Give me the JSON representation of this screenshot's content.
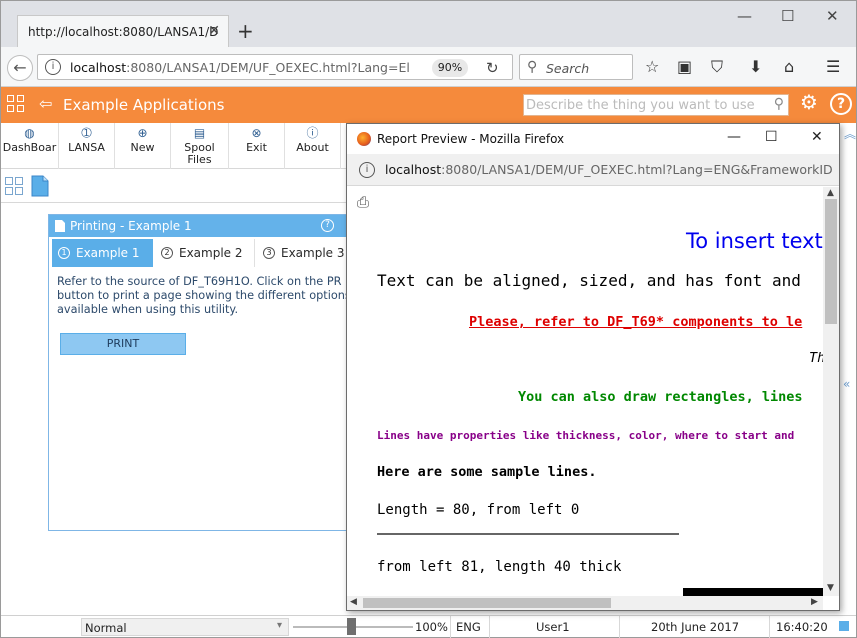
{
  "browser": {
    "tab_title": "http://localhost:8080/LANSA1/D",
    "new_tab": "+",
    "url_host": "localhost",
    "url_rest": ":8080/LANSA1/DEM/UF_OEXEC.html?Lang=El",
    "zoom": "90%",
    "search_placeholder": "Search",
    "window_min": "—",
    "window_max": "☐",
    "window_close": "✕"
  },
  "app": {
    "title": "Example Applications",
    "search_placeholder": "Describe the thing you want to use",
    "help_icon_char": "?",
    "settings_icon_char": "⚙"
  },
  "toolbar": {
    "items": [
      {
        "label": "DashBoar",
        "icon": "globe-icon",
        "glyph": "◍"
      },
      {
        "label": "LANSA",
        "icon": "info-circle-icon",
        "glyph": "➀"
      },
      {
        "label": "New",
        "icon": "plus-circle-icon",
        "glyph": "⊕"
      },
      {
        "label": "Spool Files",
        "icon": "document-icon",
        "glyph": "▤"
      },
      {
        "label": "Exit",
        "icon": "close-circle-icon",
        "glyph": "⊗"
      },
      {
        "label": "About",
        "icon": "about-icon",
        "glyph": "ⓘ"
      }
    ]
  },
  "panel": {
    "title": "Printing - Example 1",
    "tabs": [
      {
        "num": "1",
        "label": "Example 1"
      },
      {
        "num": "2",
        "label": "Example 2"
      },
      {
        "num": "3",
        "label": "Example 3"
      }
    ],
    "description_lines": [
      "Refer to the source of DF_T69H1O. Click on the PR",
      "button to print a page showing the different options",
      "available when using this utility."
    ],
    "print_button": "PRINT"
  },
  "status": {
    "mode": "Normal",
    "zoom_value_percent": 100,
    "zoom": "100%",
    "lang": "ENG",
    "user": "User1",
    "date": "20th June 2017",
    "time": "16:40:20"
  },
  "popup": {
    "title": "Report Preview - Mozilla Firefox",
    "url_host": "localhost",
    "url_rest": ":8080/LANSA1/DEM/UF_OEXEC.html?Lang=ENG&FrameworkID",
    "report_lines": [
      {
        "text": "To insert text",
        "color": "#0000ee"
      },
      {
        "text": "Text can be aligned, sized, and has font and",
        "color": "#000000"
      },
      {
        "text": "Please, refer to DF_T69* components to le",
        "color": "#dd0000"
      },
      {
        "text": "Th",
        "color": "#000000"
      },
      {
        "text": "You can also draw rectangles, lines",
        "color": "#008800"
      },
      {
        "text": "Lines have properties like thickness, color, where to start and",
        "color": "#880088"
      },
      {
        "text": "Here are some sample lines.",
        "color": "#000000"
      },
      {
        "text": "Length = 80, from left 0",
        "color": "#000000"
      },
      {
        "text": "from left 81, length 40 thick",
        "color": "#000000"
      }
    ]
  }
}
